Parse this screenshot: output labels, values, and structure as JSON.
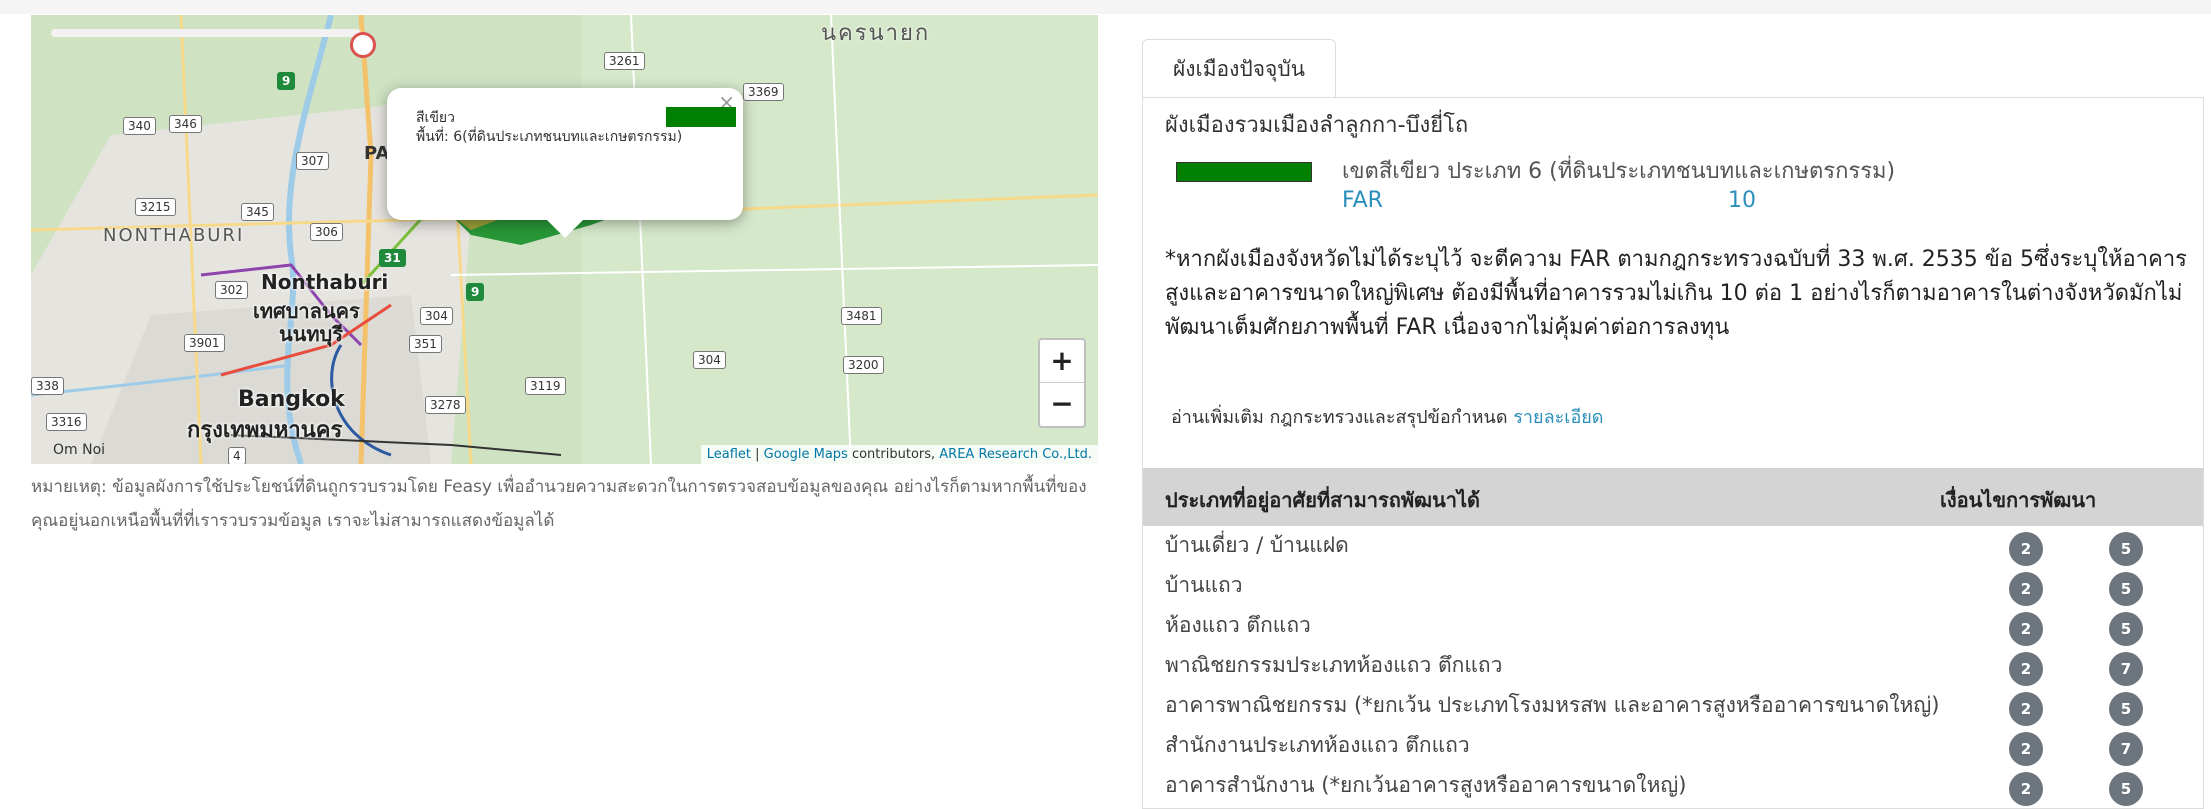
{
  "map": {
    "labels": {
      "nakhon_nayok": "นครนายก",
      "nonthaburi_province": "NONTHABURI",
      "nonthaburi_en": "Nonthaburi",
      "nonthaburi_th1": "เทศบาลนคร",
      "nonthaburi_th2": "นนทบุรี",
      "bangkok_en": "Bangkok",
      "bangkok_th": "กรุงเทพมหานคร",
      "om_noi": "Om Noi",
      "pa": "PA"
    },
    "shields": [
      "340",
      "346",
      "3215",
      "345",
      "307",
      "306",
      "302",
      "3901",
      "338",
      "3316",
      "4",
      "3261",
      "3369",
      "304",
      "351",
      "3119",
      "3278",
      "3481",
      "3200",
      "304"
    ],
    "green_shields": [
      "9",
      "31",
      "9"
    ],
    "popup": {
      "title": "สีเขียว",
      "area": "พื้นที่: 6(ที่ดินประเภทชนบทและเกษตรกรรม)",
      "close": "×",
      "swatch_color": "#008000"
    },
    "zoom_in": "+",
    "zoom_out": "−",
    "attribution": {
      "leaflet": "Leaflet",
      "sep": " | ",
      "google": "Google Maps",
      "contributors": " contributors, ",
      "area": "AREA Research Co.,Ltd."
    }
  },
  "note": "หมายเหตุ: ข้อมูลผังการใช้ประโยชน์ที่ดินถูกรวบรวมโดย Feasy เพื่ออำนวยความสะดวกในการตรวจสอบข้อมูลของคุณ อย่างไรก็ตามหากพื้นที่ของคุณอยู่นอกเหนือพื้นที่ที่เรารวบรวมข้อมูล เราจะไม่สามารถแสดงข้อมูลได้",
  "tab_label": "ผังเมืองปัจจุบัน",
  "plan_title": "ผังเมืองรวมเมืองลำลูกกา-บึงยี่โถ",
  "zone": {
    "color": "#008000",
    "description": "เขตสีเขียว ประเภท 6 (ที่ดินประเภทชนบทและเกษตรกรรม)",
    "far_label": "FAR",
    "far_value": "10"
  },
  "far_note": "*หากผังเมืองจังหวัดไม่ได้ระบุไว้ จะตีความ FAR ตามกฎกระทรวงฉบับที่ 33 พ.ศ. 2535 ข้อ 5ซึ่งระบุให้อาคารสูงและอาคารขนาดใหญ่พิเศษ ต้องมีพื้นที่อาคารรวมไม่เกิน 10 ต่อ 1 อย่างไรก็ตามอาคารในต่างจังหวัดมักไม่พัฒนาเต็มศักยภาพพื้นที่ FAR เนื่องจากไม่คุ้มค่าต่อการลงทุน",
  "more_info": {
    "text": "อ่านเพิ่มเติม กฎกระทรวงและสรุปข้อกำหนด ",
    "link": "รายละเอียด"
  },
  "table": {
    "header_type": "ประเภทที่อยู่อาศัยที่สามารถพัฒนาได้",
    "header_cond": "เงื่อนไขการพัฒนา",
    "rows": [
      {
        "label": "บ้านเดี่ยว / บ้านแฝด",
        "c1": "2",
        "c2": "5"
      },
      {
        "label": "บ้านแถว",
        "c1": "2",
        "c2": "5"
      },
      {
        "label": "ห้องแถว ตึกแถว",
        "c1": "2",
        "c2": "5"
      },
      {
        "label": "พาณิชยกรรมประเภทห้องแถว ตึกแถว",
        "c1": "2",
        "c2": "7"
      },
      {
        "label": "อาคารพาณิชยกรรม (*ยกเว้น ประเภทโรงมหรสพ และอาคารสูงหรืออาคารขนาดใหญ่)",
        "c1": "2",
        "c2": "5"
      },
      {
        "label": "สำนักงานประเภทห้องแถว ตึกแถว",
        "c1": "2",
        "c2": "7"
      },
      {
        "label": "อาคารสำนักงาน (*ยกเว้นอาคารสูงหรืออาคารขนาดใหญ่)",
        "c1": "2",
        "c2": "5"
      }
    ]
  }
}
